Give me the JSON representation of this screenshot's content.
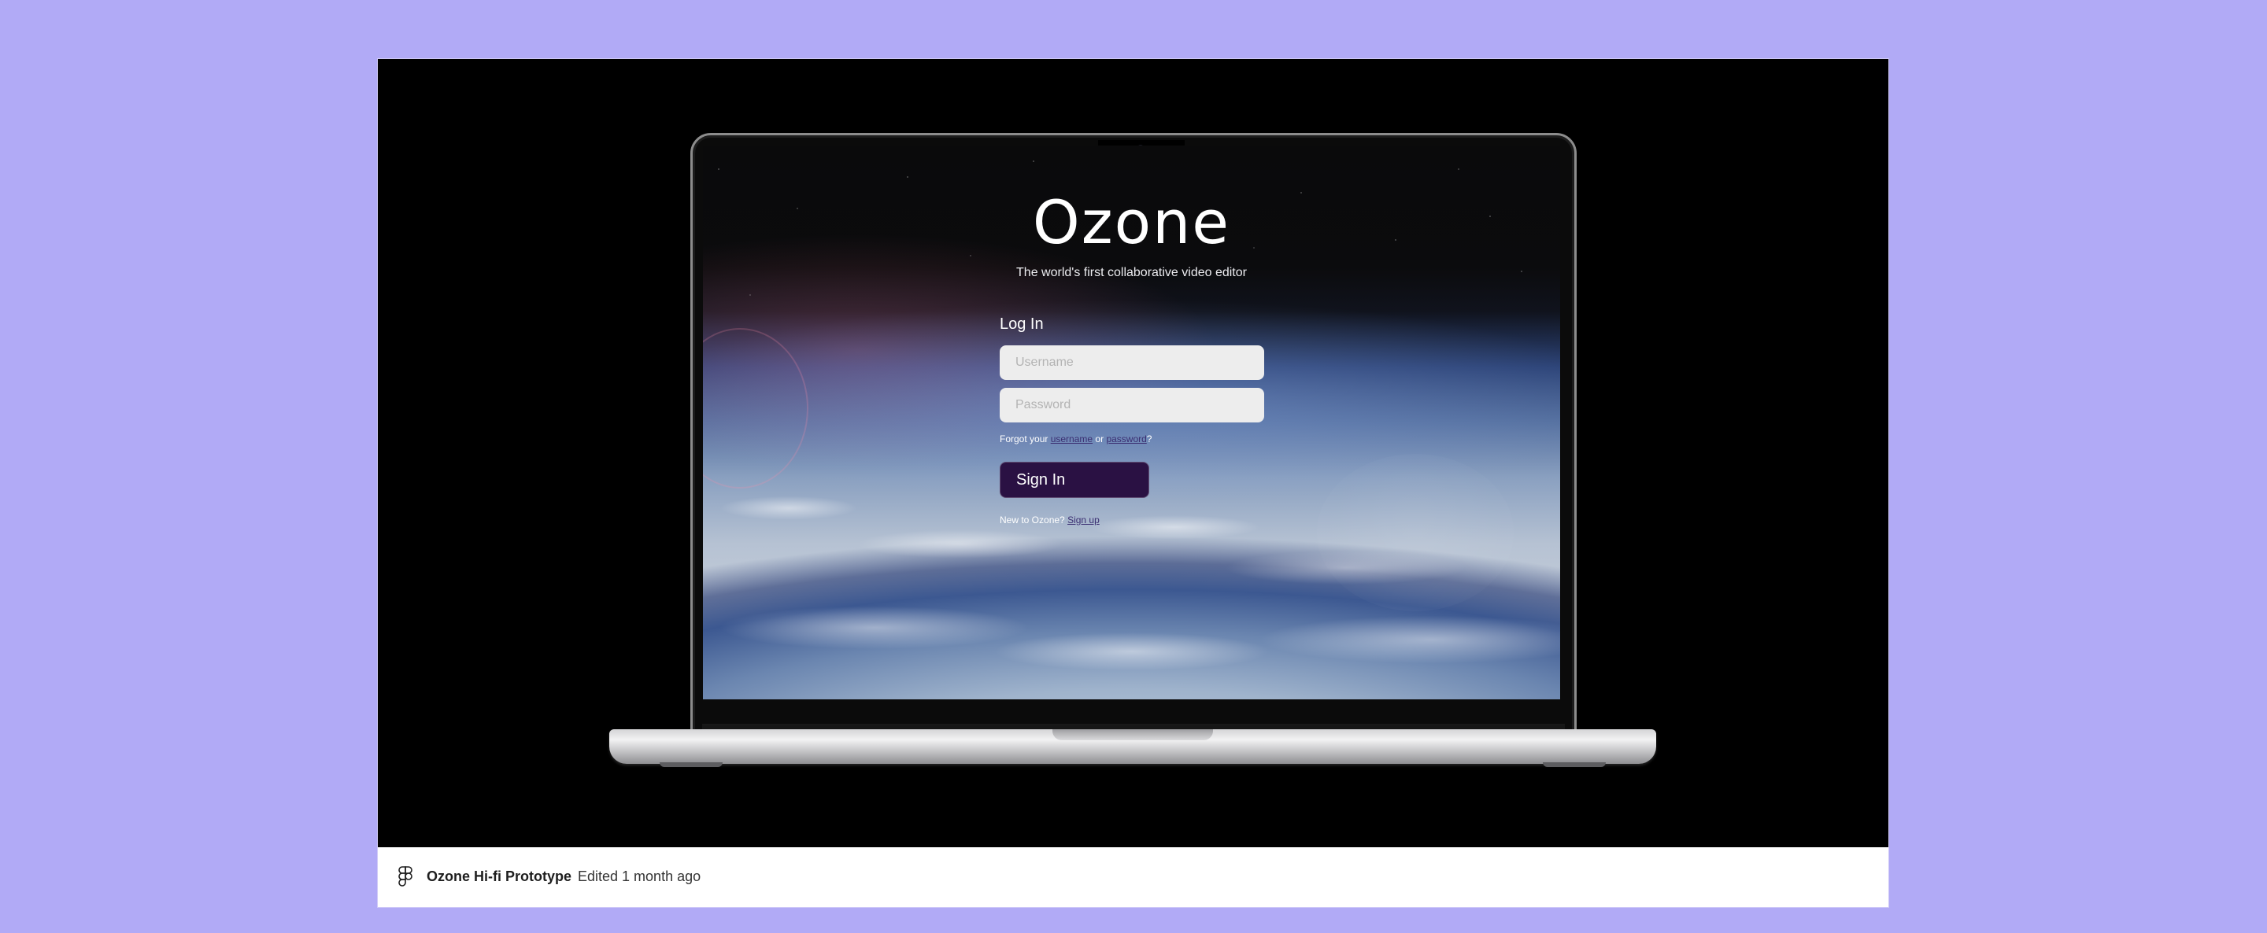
{
  "background_color": "#b1aaf6",
  "embed": {
    "file_name": "Ozone Hi-fi Prototype",
    "edited_text": "Edited 1 month ago",
    "app_icon": "figma-icon"
  },
  "login_screen": {
    "app_name": "Ozone",
    "tagline": "The world's first collaborative video editor",
    "heading": "Log In",
    "username_placeholder": "Username",
    "password_placeholder": "Password",
    "forgot_prefix": "Forgot your",
    "forgot_username_link": "username",
    "forgot_or": "or",
    "forgot_password_link": "password",
    "forgot_suffix": "?",
    "sign_in_label": "Sign In",
    "new_prefix": "New to Ozone?",
    "sign_up_link": "Sign up",
    "colors": {
      "button": "#2a1143",
      "input": "#ededed",
      "link": "#3b2f72"
    }
  }
}
